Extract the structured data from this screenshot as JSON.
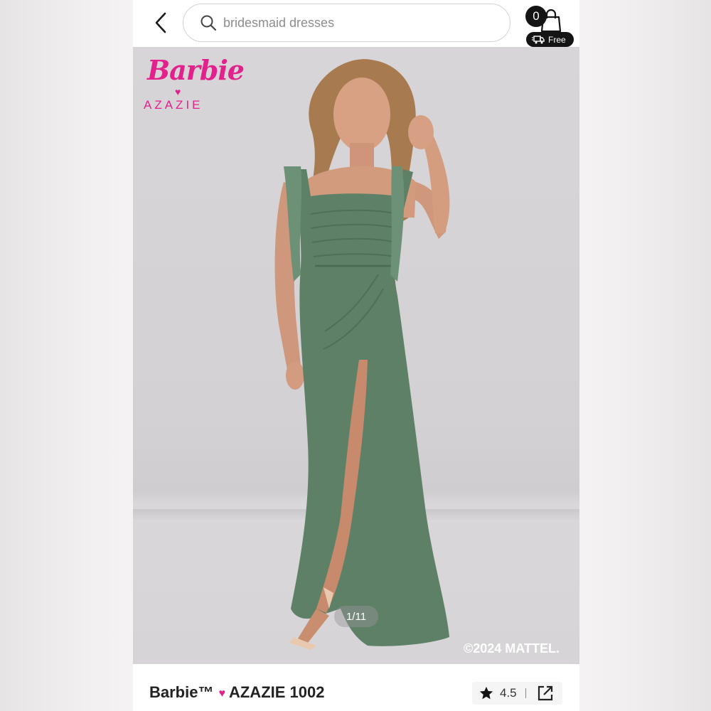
{
  "header": {
    "search_placeholder": "bridesmaid dresses",
    "cart_count": "0",
    "shipping_label": "Free"
  },
  "hero": {
    "brand_barbie": "Barbie",
    "brand_azazie": "AZAZIE",
    "image_counter": "1/11",
    "copyright": "©2024 MATTEL."
  },
  "product": {
    "title_part1": "Barbie™",
    "title_part2": "AZAZIE 1002",
    "rating": "4.5"
  },
  "colors": {
    "brand_pink": "#e3218c",
    "dress_green": "#5e8066",
    "background_gray": "#d5d3d5"
  },
  "icons": [
    "back-chevron-icon",
    "search-icon",
    "shopping-bag-icon",
    "delivery-truck-icon",
    "heart-icon",
    "star-icon",
    "share-external-icon"
  ]
}
